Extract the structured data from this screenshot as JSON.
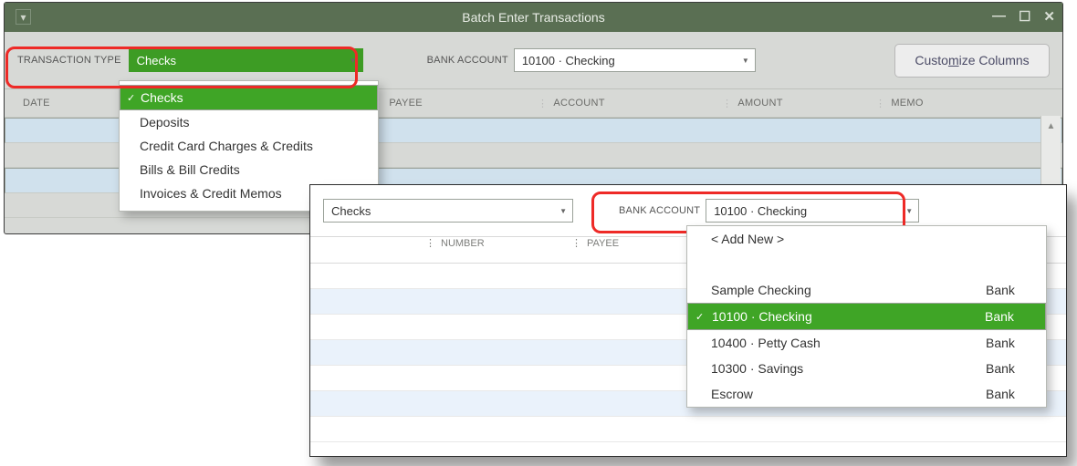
{
  "window": {
    "title": "Batch Enter Transactions"
  },
  "toolbar": {
    "transaction_type_label": "TRANSACTION TYPE",
    "transaction_type_value": "Checks",
    "bank_account_label": "BANK ACCOUNT",
    "bank_account_value": "10100 · Checking",
    "customize_button_prefix": "Custo",
    "customize_button_underline": "m",
    "customize_button_suffix": "ize Columns"
  },
  "columns": {
    "date": "DATE",
    "number": "NUMBER",
    "payee": "PAYEE",
    "account": "ACCOUNT",
    "amount": "AMOUNT",
    "memo": "MEMO"
  },
  "tt_options": [
    {
      "label": "Checks",
      "selected": true
    },
    {
      "label": "Deposits",
      "selected": false
    },
    {
      "label": "Credit Card Charges & Credits",
      "selected": false
    },
    {
      "label": "Bills & Bill Credits",
      "selected": false
    },
    {
      "label": "Invoices & Credit Memos",
      "selected": false
    }
  ],
  "overlay": {
    "transaction_type_value": "Checks",
    "bank_account_label": "BANK ACCOUNT",
    "bank_account_value": "10100 · Checking",
    "col_number": "NUMBER",
    "col_payee": "PAYEE"
  },
  "ba_options": {
    "add_new": "< Add New >",
    "items": [
      {
        "name": "Sample Checking",
        "type": "Bank",
        "selected": false
      },
      {
        "name": "10100 · Checking",
        "type": "Bank",
        "selected": true
      },
      {
        "name": "10400 · Petty Cash",
        "type": "Bank",
        "selected": false
      },
      {
        "name": "10300 · Savings",
        "type": "Bank",
        "selected": false
      },
      {
        "name": "Escrow",
        "type": "Bank",
        "selected": false
      }
    ]
  }
}
